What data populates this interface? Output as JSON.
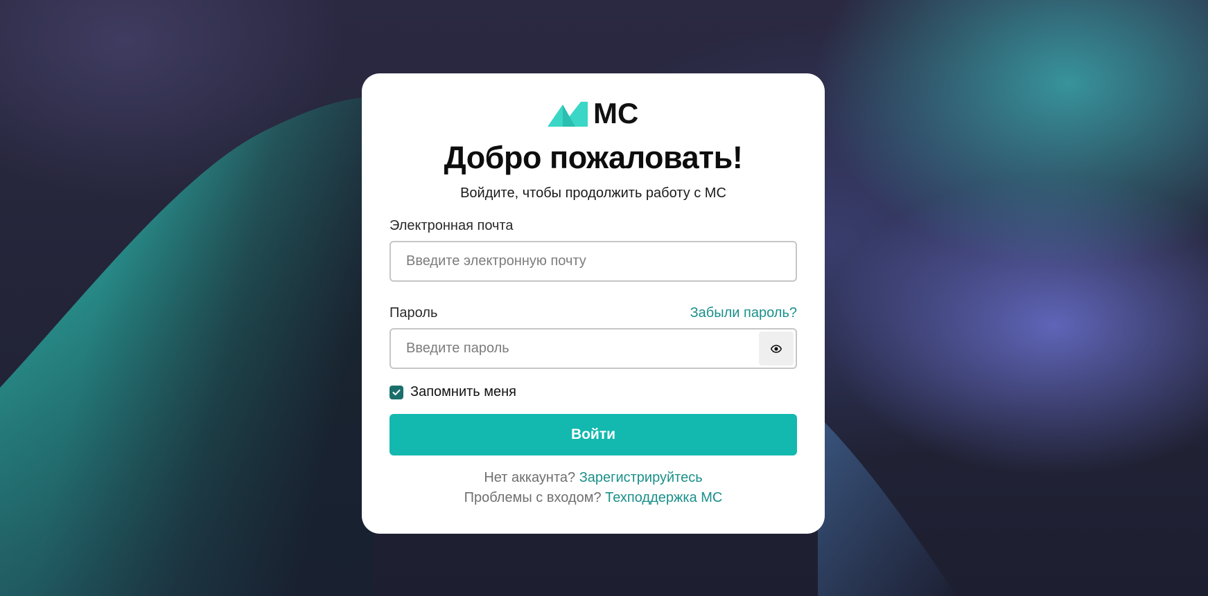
{
  "colors": {
    "accent": "#13b8ae",
    "link": "#1a8f8a",
    "checkbox": "#1b6f6b",
    "logo_mark": "#3ad6c6"
  },
  "logo": {
    "text": "МС",
    "icon": "mc-logo-mark"
  },
  "title": "Добро пожаловать!",
  "subtitle": "Войдите, чтобы продолжить работу с МС",
  "email": {
    "label": "Электронная почта",
    "placeholder": "Введите электронную почту",
    "value": ""
  },
  "password": {
    "label": "Пароль",
    "placeholder": "Введите пароль",
    "value": "",
    "forgot_link": "Забыли пароль?",
    "toggle_icon": "eye-icon"
  },
  "remember": {
    "label": "Запомнить меня",
    "checked": true
  },
  "submit_label": "Войти",
  "footer": {
    "no_account": "Нет аккаунта?",
    "register_link": "Зарегистрируйтесь",
    "problems": "Проблемы с входом?",
    "support_link": "Техподдержка МС"
  }
}
